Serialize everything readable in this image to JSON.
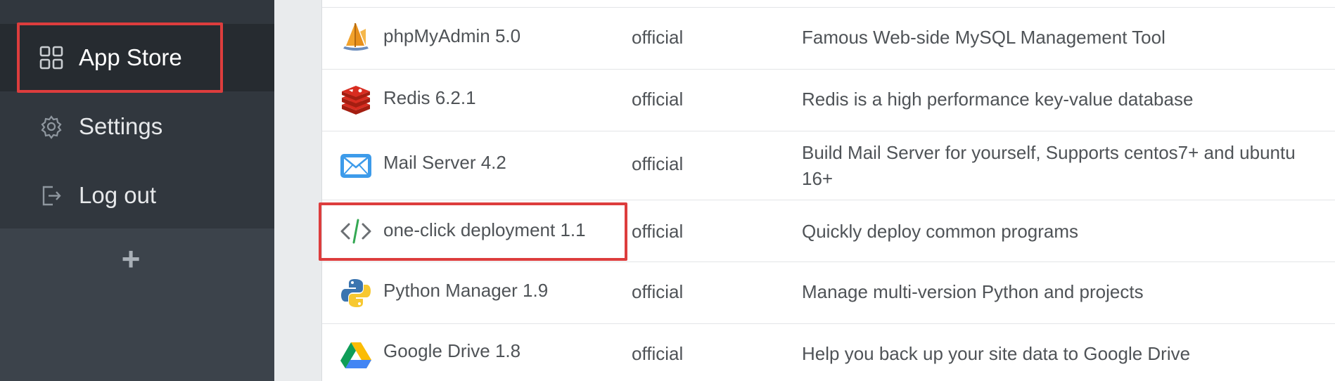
{
  "sidebar": {
    "items": [
      {
        "label": "App Store",
        "icon": "app-store-grid-icon",
        "active": true
      },
      {
        "label": "Settings",
        "icon": "gear-icon",
        "active": false
      },
      {
        "label": "Log out",
        "icon": "logout-icon",
        "active": false
      }
    ],
    "add_label": "+"
  },
  "apps": [
    {
      "name": "phpMyAdmin 5.0",
      "type": "official",
      "description": "Famous Web-side MySQL Management Tool",
      "icon": "phpmyadmin-sailboat-icon"
    },
    {
      "name": "Redis 6.2.1",
      "type": "official",
      "description": "Redis is a high performance key-value database",
      "icon": "redis-icon"
    },
    {
      "name": "Mail Server 4.2",
      "type": "official",
      "description": "Build Mail Server for yourself, Supports centos7+ and ubuntu 16+",
      "icon": "mail-envelope-icon"
    },
    {
      "name": "one-click deployment 1.1",
      "type": "official",
      "description": "Quickly deploy common programs",
      "icon": "code-brackets-icon"
    },
    {
      "name": "Python Manager 1.9",
      "type": "official",
      "description": "Manage multi-version Python and projects",
      "icon": "python-icon"
    },
    {
      "name": "Google Drive 1.8",
      "type": "official",
      "description": "Help you back up your site data to Google Drive",
      "icon": "google-drive-icon"
    }
  ],
  "colors": {
    "highlight": "#dd3d3d",
    "sidebar_bg": "#3c434b",
    "sidebar_active": "#262b30",
    "text": "#4f5357"
  }
}
